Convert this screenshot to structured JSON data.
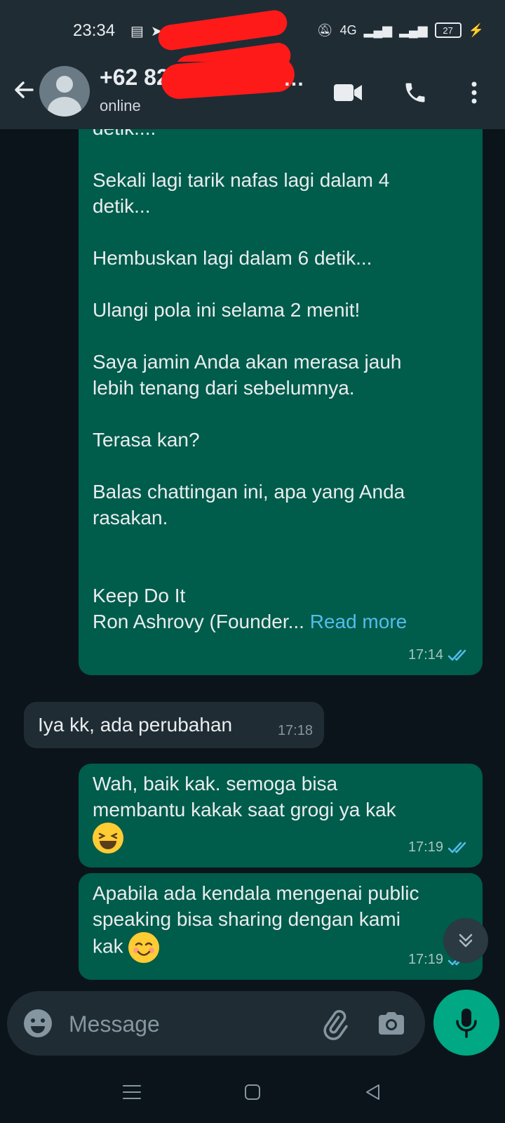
{
  "status_bar": {
    "time": "23:34",
    "network": "4G",
    "battery": "27"
  },
  "header": {
    "contact_name": "+62 82",
    "contact_status": "online",
    "icons": [
      "back-arrow-icon",
      "video-call-icon",
      "voice-call-icon",
      "more-options-icon"
    ]
  },
  "messages": [
    {
      "direction": "outgoing",
      "text": "detik....\n\nSekali lagi tarik nafas lagi dalam 4\ndetik...\n\nHembuskan lagi dalam 6 detik...\n\nUlangi pola ini selama 2 menit!\n\nSaya jamin Anda akan merasa jauh\nlebih tenang dari sebelumnya.\n\nTerasa kan?\n\nBalas chattingan ini, apa yang Anda\nrasakan.\n\n\nKeep Do It\nRon Ashrovy (Founder...",
      "read_more": "Read more",
      "time": "17:14",
      "status": "read"
    },
    {
      "direction": "incoming",
      "text": "Iya kk, ada perubahan",
      "time": "17:18"
    },
    {
      "direction": "outgoing",
      "text": "Wah, baik kak. semoga bisa\nmembantu kakak saat grogi ya kak",
      "emoji": "grinning-squinting-face",
      "time": "17:19",
      "status": "read"
    },
    {
      "direction": "outgoing",
      "text": "Apabila ada kendala mengenai public\nspeaking bisa sharing dengan kami\nkak",
      "emoji": "smiling-face",
      "time": "17:19",
      "status": "read"
    }
  ],
  "composer": {
    "placeholder": "Message"
  },
  "colors": {
    "outgoing_bubble": "#005c4b",
    "incoming_bubble": "#202c33",
    "accent": "#00a884",
    "link": "#53bdeb",
    "tick_read": "#53bdeb"
  }
}
